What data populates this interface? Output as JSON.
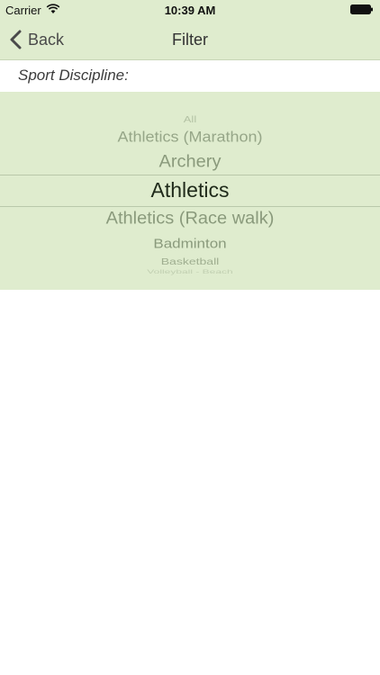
{
  "status_bar": {
    "carrier": "Carrier",
    "time": "10:39 AM"
  },
  "nav": {
    "back_label": "Back",
    "title": "Filter"
  },
  "filter": {
    "section_label": "Sport Discipline:",
    "selected": "Athletics",
    "options": [
      "All",
      "Athletics (Marathon)",
      "Archery",
      "Athletics",
      "Athletics (Race walk)",
      "Badminton",
      "Basketball",
      "Volleyball - Beach"
    ]
  },
  "colors": {
    "header_background": "#dfecce",
    "picker_background": "#dfecce",
    "selected_text": "#1f2a1a",
    "unselected_text": "#8a9a7c"
  }
}
